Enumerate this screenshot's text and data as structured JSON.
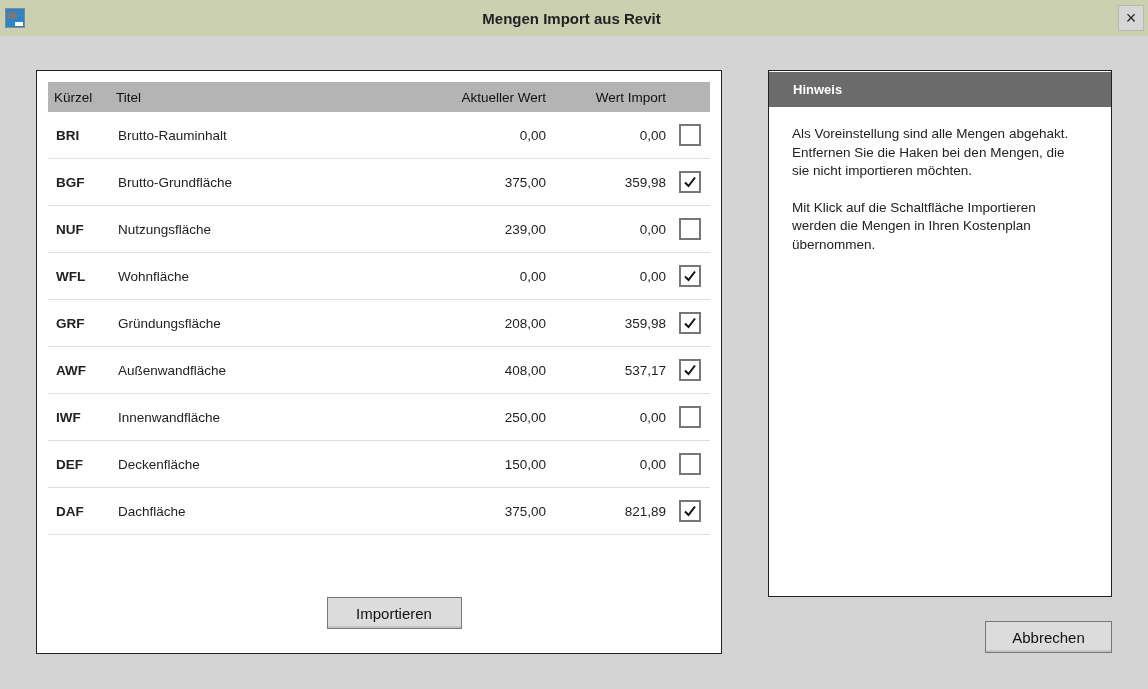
{
  "window": {
    "title": "Mengen Import aus Revit",
    "close": "×"
  },
  "table": {
    "columns": [
      "Kürzel",
      "Titel",
      "Aktueller Wert",
      "Wert Import"
    ],
    "rows": [
      {
        "code": "BRI",
        "title": "Brutto-Rauminhalt",
        "current": "0,00",
        "import": "0,00",
        "checked": false
      },
      {
        "code": "BGF",
        "title": "Brutto-Grundfläche",
        "current": "375,00",
        "import": "359,98",
        "checked": true
      },
      {
        "code": "NUF",
        "title": "Nutzungsfläche",
        "current": "239,00",
        "import": "0,00",
        "checked": false
      },
      {
        "code": "WFL",
        "title": "Wohnfläche",
        "current": "0,00",
        "import": "0,00",
        "checked": true
      },
      {
        "code": "GRF",
        "title": "Gründungsfläche",
        "current": "208,00",
        "import": "359,98",
        "checked": true
      },
      {
        "code": "AWF",
        "title": "Außenwandfläche",
        "current": "408,00",
        "import": "537,17",
        "checked": true
      },
      {
        "code": "IWF",
        "title": "Innenwandfläche",
        "current": "250,00",
        "import": "0,00",
        "checked": false
      },
      {
        "code": "DEF",
        "title": "Deckenfläche",
        "current": "150,00",
        "import": "0,00",
        "checked": false
      },
      {
        "code": "DAF",
        "title": "Dachfläche",
        "current": "375,00",
        "import": "821,89",
        "checked": true
      }
    ]
  },
  "import_button": "Importieren",
  "hint": {
    "title": "Hinweis",
    "paragraphs": [
      "Als Voreinstellung sind alle Mengen abgehakt. Entfernen Sie die Haken bei den Mengen, die sie nicht importieren möchten.",
      "Mit Klick auf die Schaltfläche Importieren werden die Mengen in Ihren Kostenplan übernommen."
    ]
  },
  "cancel_button": "Abbrechen"
}
